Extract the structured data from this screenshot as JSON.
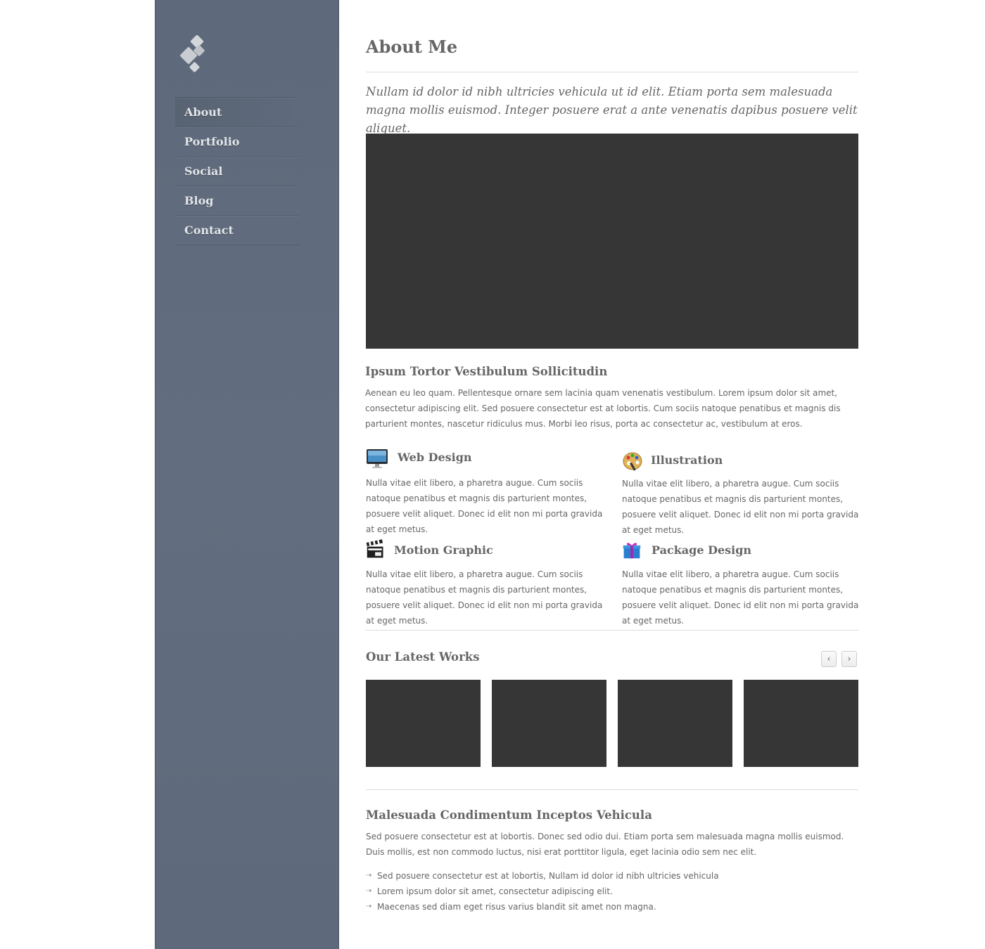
{
  "nav": {
    "items": [
      {
        "label": "About",
        "active": true
      },
      {
        "label": "Portfolio"
      },
      {
        "label": "Social"
      },
      {
        "label": "Blog"
      },
      {
        "label": "Contact"
      }
    ]
  },
  "page": {
    "title": "About Me",
    "lead": "Nullam id dolor id nibh ultricies vehicula ut id elit. Etiam porta sem malesuada magna mollis euismod. Integer posuere erat a ante venenatis dapibus posuere velit aliquet."
  },
  "intro": {
    "heading": "Ipsum Tortor Vestibulum Sollicitudin",
    "body": "Aenean eu leo quam. Pellentesque ornare sem lacinia quam venenatis vestibulum. Lorem ipsum dolor sit amet, consectetur adipiscing elit. Sed posuere consectetur est at lobortis. Cum sociis natoque penatibus et magnis dis parturient montes, nascetur ridiculus mus. Morbi leo risus, porta ac consectetur ac, vestibulum at eros."
  },
  "services": [
    {
      "title": "Web Design",
      "icon": "monitor-icon",
      "body": "Nulla vitae elit libero, a pharetra augue. Cum sociis natoque penatibus et magnis dis parturient montes, posuere velit aliquet. Donec id elit non mi porta gravida at eget metus."
    },
    {
      "title": "Illustration",
      "icon": "palette-icon",
      "body": "Nulla vitae elit libero, a pharetra augue. Cum sociis natoque penatibus et magnis dis parturient montes, posuere velit aliquet. Donec id elit non mi porta gravida at eget metus."
    },
    {
      "title": "Motion Graphic",
      "icon": "clapperboard-icon",
      "body": "Nulla vitae elit libero, a pharetra augue. Cum sociis natoque penatibus et magnis dis parturient montes, posuere velit aliquet. Donec id elit non mi porta gravida at eget metus."
    },
    {
      "title": "Package Design",
      "icon": "gift-box-icon",
      "body": "Nulla vitae elit libero, a pharetra augue. Cum sociis natoque penatibus et magnis dis parturient montes, posuere velit aliquet. Donec id elit non mi porta gravida at eget metus."
    }
  ],
  "works": {
    "title": "Our Latest Works",
    "prev_label": "‹",
    "next_label": "›"
  },
  "closing": {
    "heading": "Malesuada Condimentum Inceptos Vehicula",
    "body": "Sed posuere consectetur est at lobortis. Donec sed odio dui. Etiam porta sem malesuada magna mollis euismod. Duis mollis, est non commodo luctus, nisi erat porttitor ligula, eget lacinia odio sem nec elit.",
    "list": [
      "Sed posuere consectetur est at lobortis, Nullam id dolor id nibh ultricies vehicula",
      "Lorem ipsum dolor sit amet, consectetur adipiscing elit.",
      "Maecenas sed diam eget risus varius blandit sit amet non magna."
    ]
  },
  "colors": {
    "sidebar": "#616d7e",
    "placeholder": "#363636",
    "text": "#666666"
  }
}
